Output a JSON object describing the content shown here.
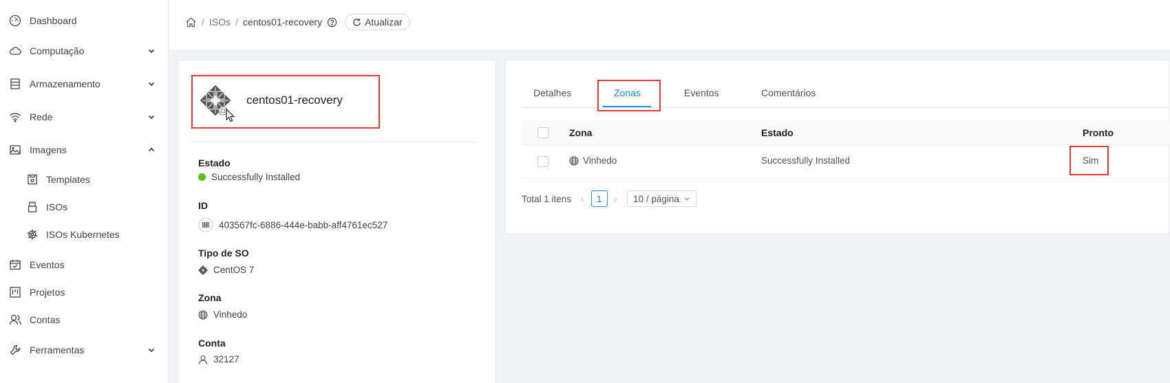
{
  "sidebar": {
    "items": [
      {
        "label": "Dashboard",
        "icon": "dashboard-icon"
      },
      {
        "label": "Computação",
        "icon": "cloud-icon"
      },
      {
        "label": "Armazenamento",
        "icon": "storage-icon"
      },
      {
        "label": "Rede",
        "icon": "wifi-icon"
      },
      {
        "label": "Imagens",
        "icon": "picture-icon"
      },
      {
        "label": "Templates",
        "icon": "template-icon"
      },
      {
        "label": "ISOs",
        "icon": "usb-icon"
      },
      {
        "label": "ISOs Kubernetes",
        "icon": "kubernetes-icon"
      },
      {
        "label": "Eventos",
        "icon": "calendar-icon"
      },
      {
        "label": "Projetos",
        "icon": "project-icon"
      },
      {
        "label": "Contas",
        "icon": "team-icon"
      },
      {
        "label": "Ferramentas",
        "icon": "tool-icon"
      }
    ]
  },
  "breadcrumb": {
    "isos": "ISOs",
    "current": "centos01-recovery"
  },
  "header": {
    "refresh_label": "Atualizar"
  },
  "details": {
    "title": "centos01-recovery",
    "estado_label": "Estado",
    "estado_value": "Successfully Installed",
    "status_color": "#52c41a",
    "id_label": "ID",
    "id_value": "403567fc-6886-444e-babb-aff4761ec527",
    "os_label": "Tipo de SO",
    "os_value": "CentOS 7",
    "zona_label": "Zona",
    "zona_value": "Vinhedo",
    "conta_label": "Conta",
    "conta_value": "32127"
  },
  "tabs": {
    "detalhes": "Detalhes",
    "zonas": "Zonas",
    "eventos": "Eventos",
    "comentarios": "Comentários"
  },
  "table": {
    "headers": {
      "zona": "Zona",
      "estado": "Estado",
      "pronto": "Pronto"
    },
    "rows": [
      {
        "zona": "Vinhedo",
        "estado": "Successfully Installed",
        "pronto": "Sim"
      }
    ]
  },
  "pagination": {
    "total": "Total 1 itens",
    "page": "1",
    "page_size": "10 / página"
  },
  "colors": {
    "accent": "#1890ff",
    "highlight": "#e53935"
  }
}
